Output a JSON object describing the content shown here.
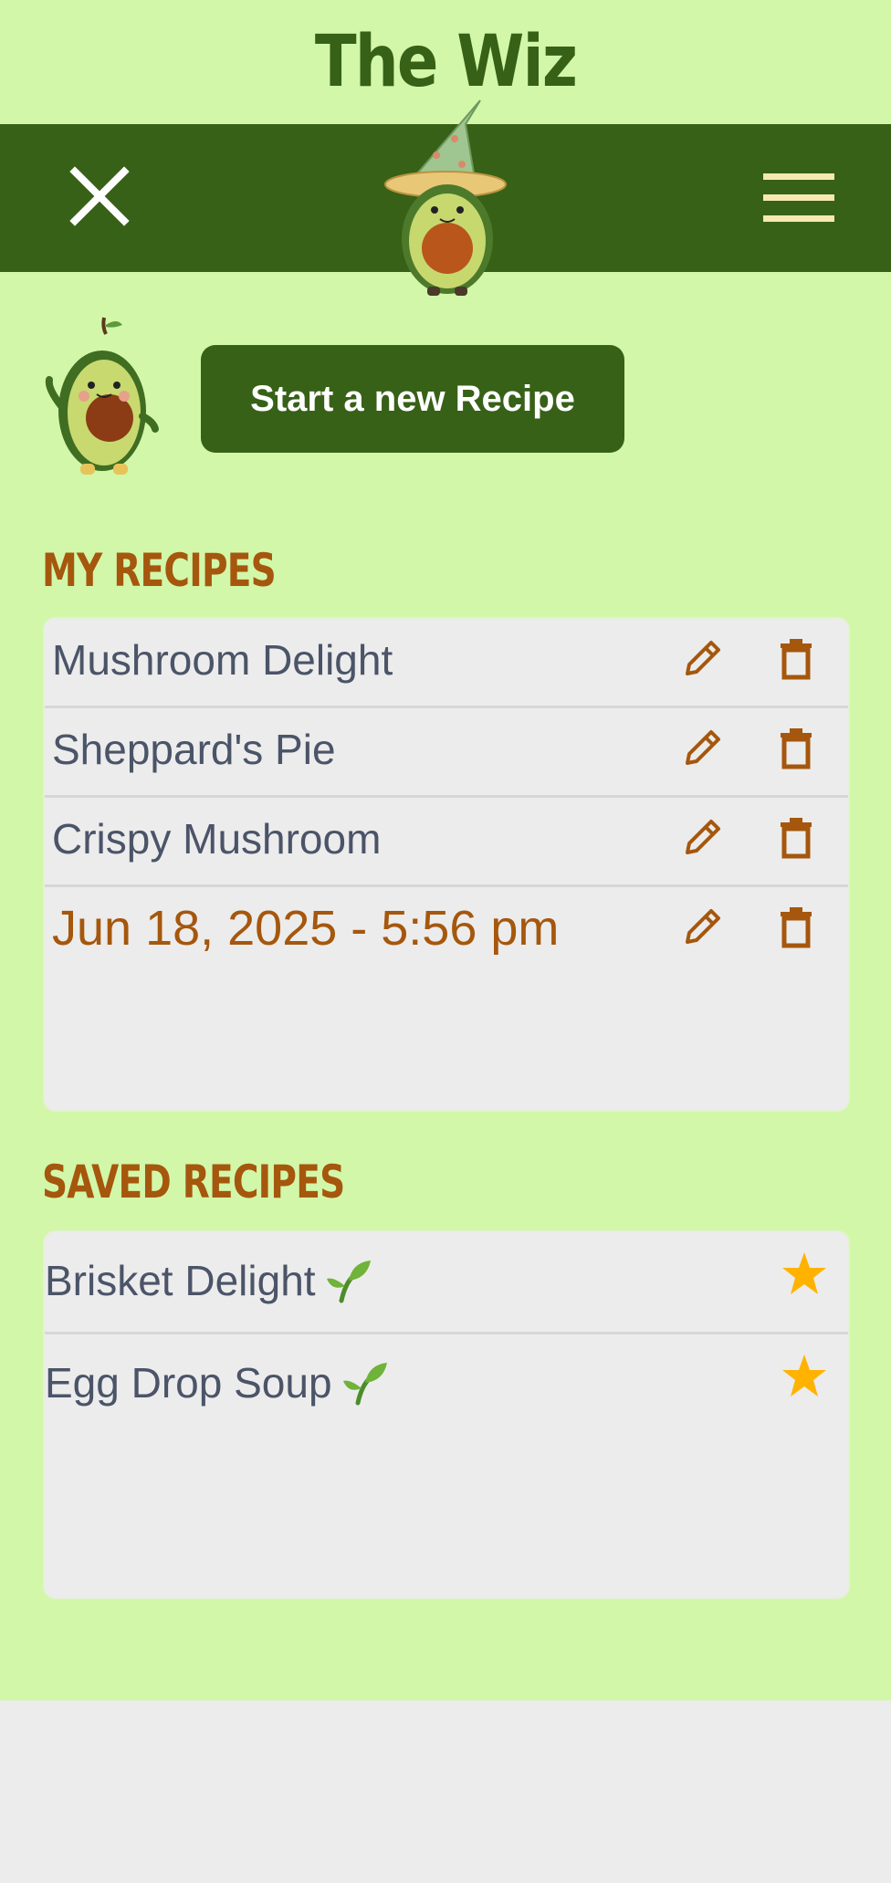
{
  "app": {
    "title": "The Wiz"
  },
  "actions": {
    "new_recipe_label": "Start a new Recipe"
  },
  "my_recipes": {
    "heading": "MY RECIPES",
    "items": [
      {
        "name": "Mushroom Delight"
      },
      {
        "name": "Sheppard's Pie"
      },
      {
        "name": "Crispy Mushroom"
      },
      {
        "name": "Jun 18, 2025 - 5:56 pm"
      }
    ]
  },
  "saved_recipes": {
    "heading": "SAVED RECIPES",
    "items": [
      {
        "name": "Brisket Delight",
        "tag_icon": "sprout-icon",
        "starred": true
      },
      {
        "name": "Egg Drop Soup",
        "tag_icon": "sprout-icon",
        "starred": true
      }
    ]
  },
  "colors": {
    "background": "#d2f7a9",
    "nav_bar": "#376117",
    "accent_brown": "#a5570d",
    "panel": "#ececec",
    "text": "#4b5468",
    "star": "#ffb300",
    "menu_lines": "#f6e8b1"
  },
  "icons": {
    "close": "close-icon",
    "menu": "hamburger-menu-icon",
    "edit": "pencil-icon",
    "delete": "trash-icon",
    "star": "star-icon"
  }
}
